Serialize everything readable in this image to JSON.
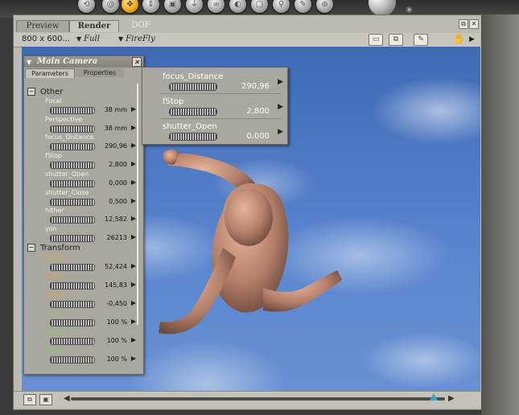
{
  "toolbar": {
    "tools": [
      "rotate-tool",
      "twist-tool",
      "translate-tool",
      "translate-in-out-tool",
      "scale-tool",
      "taper-tool",
      "chain-break-tool",
      "color-tool",
      "view-magnifier-tool",
      "direct-manipulation-tool",
      "morphing-tool",
      "grouping-tool"
    ],
    "active_tool": "translate-tool"
  },
  "tabs": {
    "preview": "Preview",
    "render": "Render",
    "dof": "DOF"
  },
  "render_bar": {
    "size": "800 x 600...",
    "quality": "Full",
    "engine": "FireFly"
  },
  "camera_panel": {
    "title": "Main Camera",
    "tab_parameters": "Parameters",
    "tab_properties": "Properties",
    "sections": {
      "other": "Other",
      "transform": "Transform"
    },
    "params": [
      {
        "name": "Focal",
        "value": "38 mm",
        "color": "#f4f2ec"
      },
      {
        "name": "Perspective",
        "value": "38 mm",
        "color": "#f4f2ec"
      },
      {
        "name": "focus_Distance",
        "value": "290,96",
        "color": "#f4f2ec"
      },
      {
        "name": "fStop",
        "value": "2,800",
        "color": "#f4f2ec"
      },
      {
        "name": "shutter_Open",
        "value": "0,000",
        "color": "#f4f2ec"
      },
      {
        "name": "shutter_Close",
        "value": "0,500",
        "color": "#f4f2ec"
      },
      {
        "name": "hither",
        "value": "12,582",
        "color": "#f4f2ec"
      },
      {
        "name": "yon",
        "value": "26213",
        "color": "#f4f2ec"
      }
    ],
    "transform_params": [
      {
        "name": "DollyZ",
        "value": "52,424",
        "color": "#d9a65b"
      },
      {
        "name": "DollyY",
        "value": "145,83",
        "color": "#d9a65b"
      },
      {
        "name": "DollyX",
        "value": "-0,450",
        "color": "#d9a65b"
      },
      {
        "name": "zScale",
        "value": "100 %",
        "color": "#86c96f"
      },
      {
        "name": "yScale",
        "value": "100 %",
        "color": "#86c96f"
      },
      {
        "name": "xScale",
        "value": "100 %",
        "color": "#86c96f"
      }
    ]
  },
  "dof_popup": {
    "rows": [
      {
        "name": "focus_Distance",
        "value": "290,96"
      },
      {
        "name": "fStop",
        "value": "2,800"
      },
      {
        "name": "shutter_Open",
        "value": "0,000"
      }
    ]
  },
  "timeline": {
    "position": 0.97
  }
}
